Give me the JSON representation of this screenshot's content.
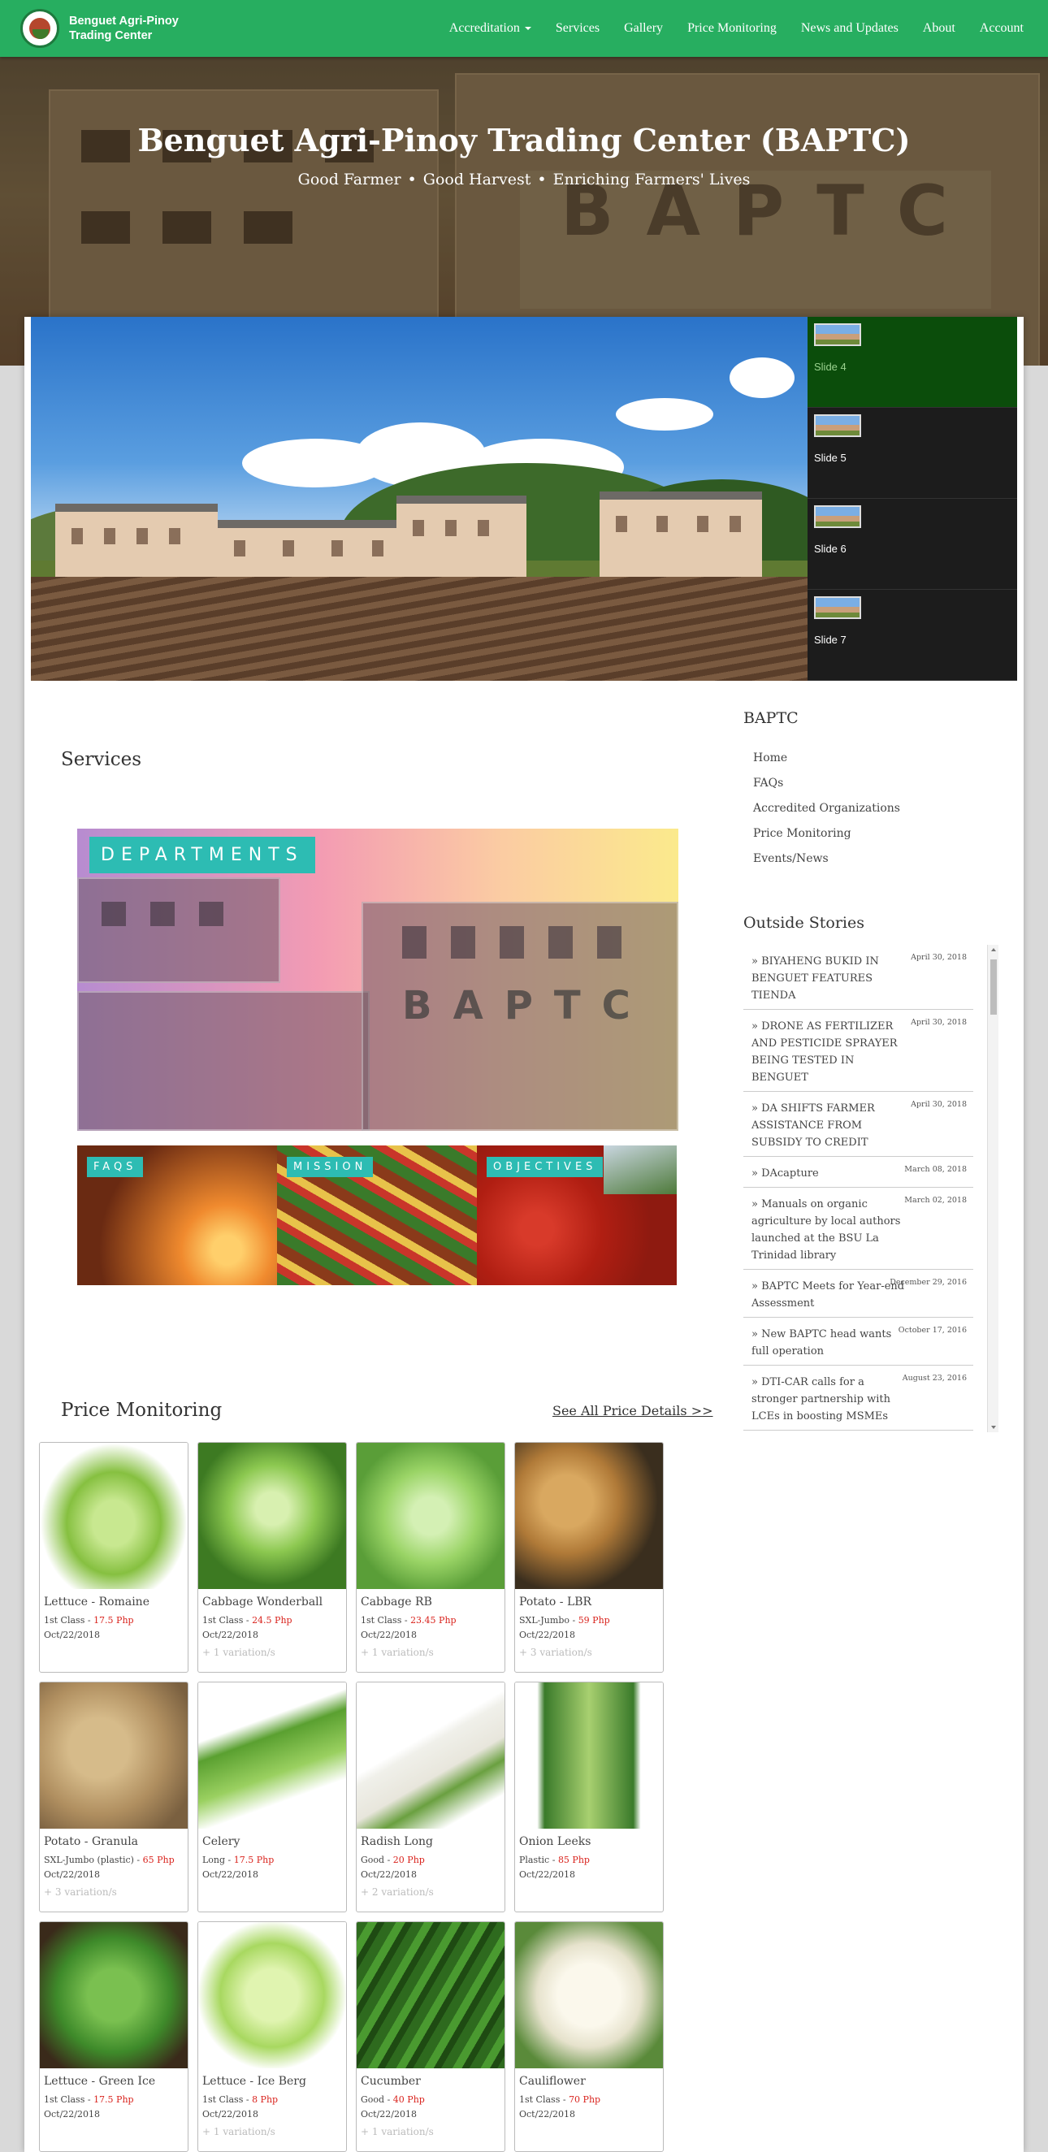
{
  "navbar": {
    "brand_line1": "Benguet Agri-Pinoy",
    "brand_line2": "Trading Center",
    "items": [
      {
        "label": "Accreditation",
        "dropdown": true
      },
      {
        "label": "Services"
      },
      {
        "label": "Gallery"
      },
      {
        "label": "Price Monitoring"
      },
      {
        "label": "News and Updates"
      },
      {
        "label": "About"
      },
      {
        "label": "Account"
      }
    ]
  },
  "hero": {
    "title": "Benguet Agri-Pinoy Trading Center (BAPTC)",
    "tagline": [
      "Good Farmer",
      "Good Harvest",
      "Enriching Farmers' Lives"
    ],
    "banner_text": "BAPTC"
  },
  "slider": {
    "thumbs": [
      {
        "label": "Slide 4",
        "active": true
      },
      {
        "label": "Slide 5",
        "active": false
      },
      {
        "label": "Slide 6",
        "active": false
      },
      {
        "label": "Slide 7",
        "active": false
      }
    ]
  },
  "services": {
    "title": "Services",
    "departments_label": "DEPARTMENTS",
    "dept_banner": "BAPTC",
    "tiles": [
      "FAQS",
      "MISSION",
      "OBJECTIVES"
    ]
  },
  "price": {
    "title": "Price Monitoring",
    "see_all": "See All Price Details >>",
    "products": [
      {
        "name": "Lettuce - Romaine",
        "grade": "1st Class - ",
        "price": "17.5 Php",
        "date": "Oct/22/2018",
        "variations": ""
      },
      {
        "name": "Cabbage Wonderball",
        "grade": "1st Class - ",
        "price": "24.5 Php",
        "date": "Oct/22/2018",
        "variations": "+ 1 variation/s"
      },
      {
        "name": "Cabbage RB",
        "grade": "1st Class - ",
        "price": "23.45 Php",
        "date": "Oct/22/2018",
        "variations": "+ 1 variation/s"
      },
      {
        "name": "Potato - LBR",
        "grade": "SXL-Jumbo - ",
        "price": "59 Php",
        "date": "Oct/22/2018",
        "variations": "+ 3 variation/s"
      },
      {
        "name": "Potato - Granula",
        "grade": "SXL-Jumbo (plastic) - ",
        "price": "65 Php",
        "date": "Oct/22/2018",
        "variations": "+ 3 variation/s"
      },
      {
        "name": "Celery",
        "grade": "Long - ",
        "price": "17.5 Php",
        "date": "Oct/22/2018",
        "variations": ""
      },
      {
        "name": "Radish Long",
        "grade": "Good - ",
        "price": "20 Php",
        "date": "Oct/22/2018",
        "variations": "+ 2 variation/s"
      },
      {
        "name": "Onion Leeks",
        "grade": "Plastic - ",
        "price": "85 Php",
        "date": "Oct/22/2018",
        "variations": ""
      },
      {
        "name": "Lettuce - Green Ice",
        "grade": "1st Class - ",
        "price": "17.5 Php",
        "date": "Oct/22/2018",
        "variations": ""
      },
      {
        "name": "Lettuce - Ice Berg",
        "grade": "1st Class - ",
        "price": "8 Php",
        "date": "Oct/22/2018",
        "variations": "+ 1 variation/s"
      },
      {
        "name": "Cucumber",
        "grade": "Good - ",
        "price": "40 Php",
        "date": "Oct/22/2018",
        "variations": "+ 1 variation/s"
      },
      {
        "name": "Cauliflower",
        "grade": "1st Class - ",
        "price": "70 Php",
        "date": "Oct/22/2018",
        "variations": ""
      }
    ]
  },
  "sidebar": {
    "title": "BAPTC",
    "links": [
      "Home",
      "FAQs",
      "Accredited Organizations",
      "Price Monitoring",
      "Events/News"
    ],
    "stories_title": "Outside Stories",
    "stories": [
      {
        "title": "» BIYAHENG BUKID IN BENGUET FEATURES TIENDA",
        "date": "April 30, 2018"
      },
      {
        "title": "» DRONE AS FERTILIZER AND PESTICIDE SPRAYER BEING TESTED IN BENGUET",
        "date": "April 30, 2018"
      },
      {
        "title": "» DA SHIFTS FARMER ASSISTANCE FROM SUBSIDY TO CREDIT",
        "date": "April 30, 2018"
      },
      {
        "title": "» DAcapture",
        "date": "March 08, 2018"
      },
      {
        "title": "» Manuals on organic agriculture by local authors launched at the BSU La Trinidad library",
        "date": "March 02, 2018"
      },
      {
        "title": "» BAPTC Meets for Year-end Assessment",
        "date": "December 29, 2016"
      },
      {
        "title": "» New BAPTC head wants full operation",
        "date": "October 17, 2016"
      },
      {
        "title": "» DTI-CAR calls for a stronger partnership with LCEs in boosting MSMEs",
        "date": "August 23, 2016"
      }
    ]
  }
}
